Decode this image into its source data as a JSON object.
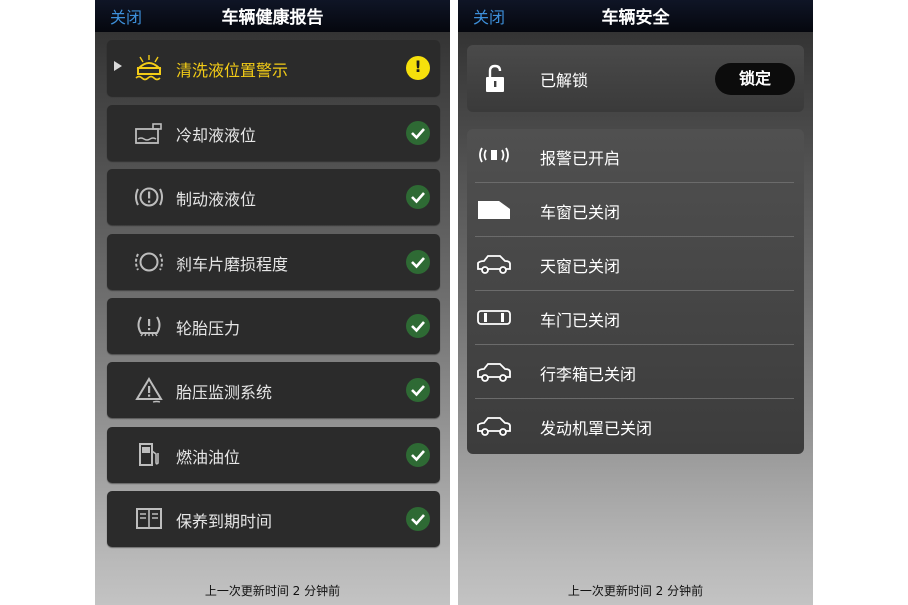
{
  "health": {
    "close": "关闭",
    "title": "车辆健康报告",
    "items": [
      {
        "label": "清洗液位置警示",
        "icon": "washer-fluid-icon",
        "status": "warning",
        "status_symbol": "!"
      },
      {
        "label": "冷却液液位",
        "icon": "coolant-icon",
        "status": "ok"
      },
      {
        "label": "制动液液位",
        "icon": "brake-fluid-icon",
        "status": "ok"
      },
      {
        "label": "刹车片磨损程度",
        "icon": "brake-pad-icon",
        "status": "ok"
      },
      {
        "label": "轮胎压力",
        "icon": "tire-pressure-icon",
        "status": "ok"
      },
      {
        "label": "胎压监测系统",
        "icon": "tpms-icon",
        "status": "ok"
      },
      {
        "label": "燃油油位",
        "icon": "fuel-pump-icon",
        "status": "ok"
      },
      {
        "label": "保养到期时间",
        "icon": "service-book-icon",
        "status": "ok"
      }
    ],
    "footer": "上一次更新时间 2 分钟前"
  },
  "security": {
    "close": "关闭",
    "title": "车辆安全",
    "lock_status": "已解锁",
    "lock_button": "锁定",
    "rows": [
      {
        "label": "报警已开启",
        "icon": "alarm-icon"
      },
      {
        "label": "车窗已关闭",
        "icon": "window-icon"
      },
      {
        "label": "天窗已关闭",
        "icon": "sunroof-icon"
      },
      {
        "label": "车门已关闭",
        "icon": "door-icon"
      },
      {
        "label": "行李箱已关闭",
        "icon": "trunk-icon"
      },
      {
        "label": "发动机罩已关闭",
        "icon": "hood-icon"
      }
    ],
    "footer": "上一次更新时间 2 分钟前"
  },
  "colors": {
    "warning_text": "#f3cc17",
    "warning_badge": "#f6e00c",
    "ok_badge": "#2e6a34",
    "link": "#3d8fd9"
  }
}
